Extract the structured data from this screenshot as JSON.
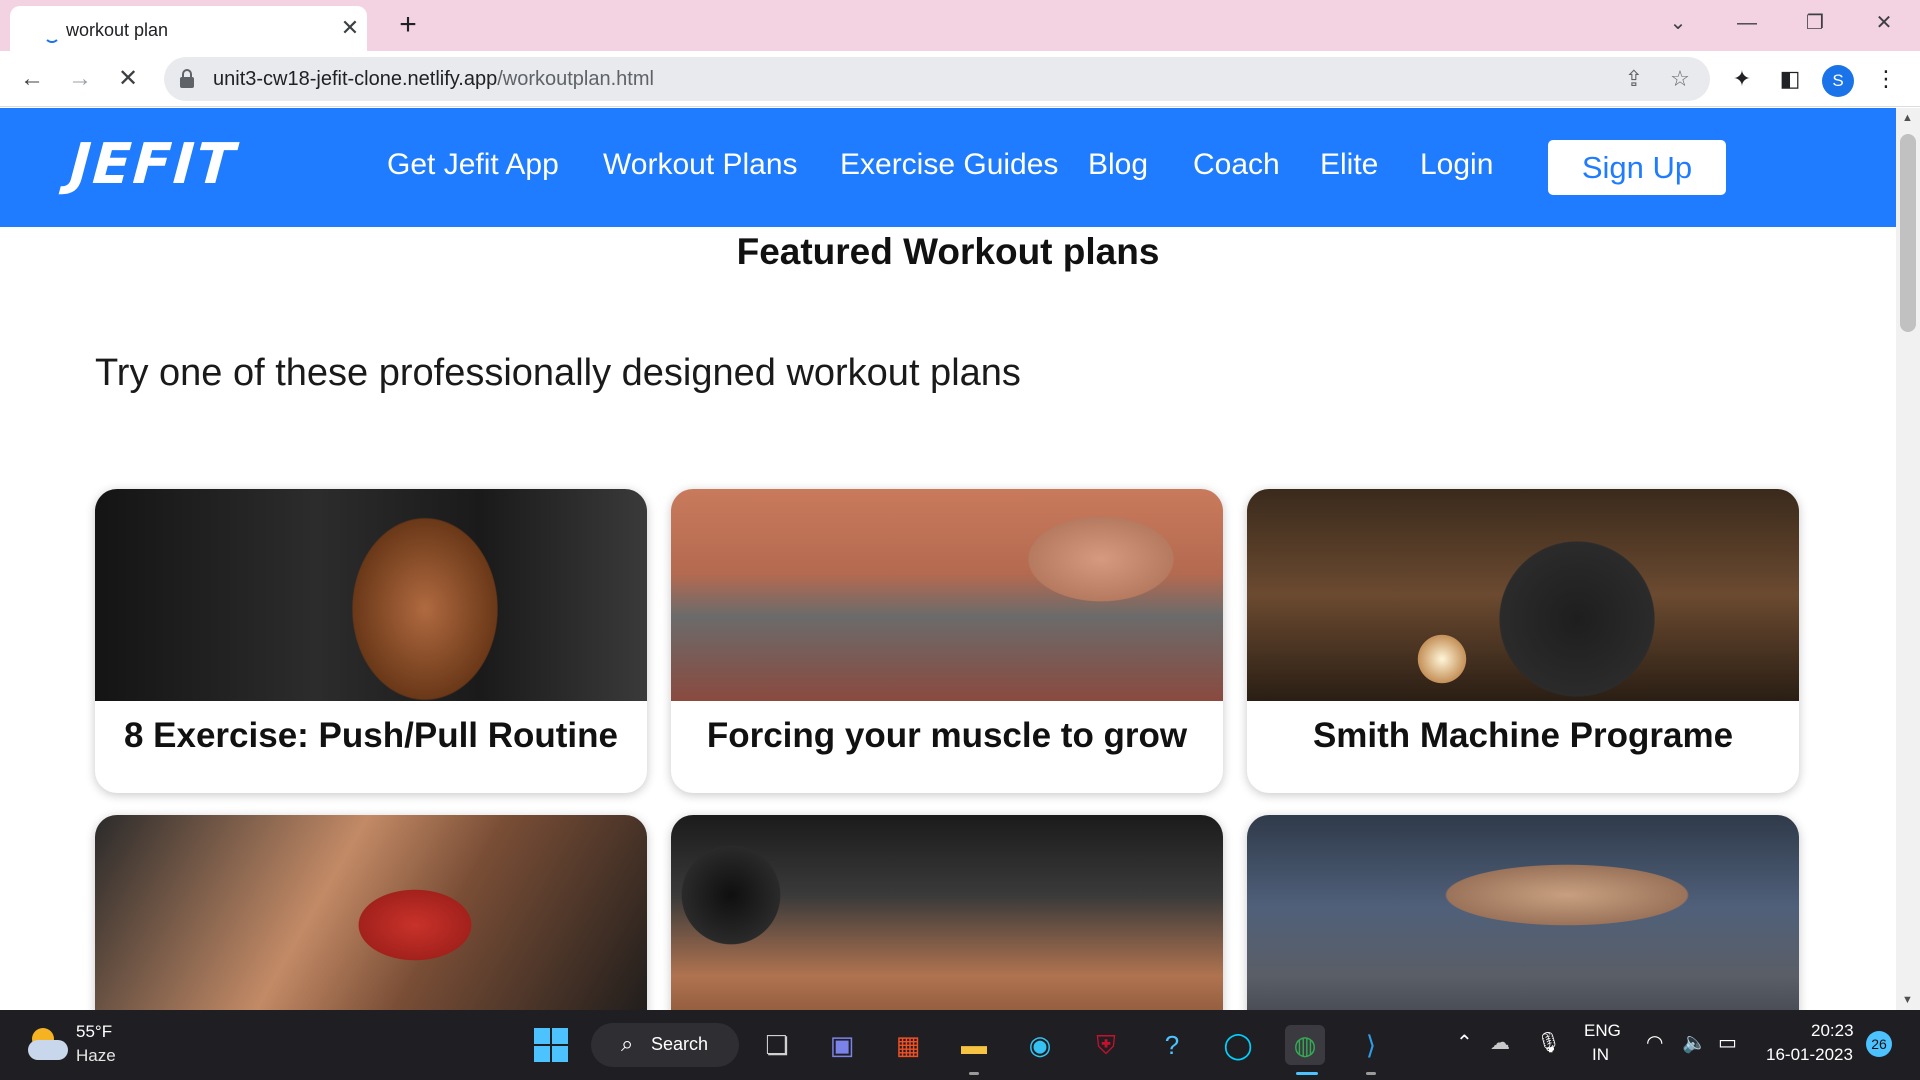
{
  "browser": {
    "tab_title": "workout plan",
    "tab_close": "✕",
    "new_tab": "+",
    "url_domain": "unit3-cw18-jefit-clone.netlify.app",
    "url_path": "/workoutplan.html",
    "profile_initial": "S"
  },
  "site": {
    "logo": "JEFIT",
    "nav": [
      "Get Jefit App",
      "Workout Plans",
      "Exercise Guides",
      "Blog",
      "Coach",
      "Elite",
      "Login"
    ],
    "signup": "Sign Up",
    "heading": "Featured Workout plans",
    "subtitle": "Try one of these professionally designed workout plans",
    "cards": [
      {
        "title": "8 Exercise: Push/Pull Routine"
      },
      {
        "title": "Forcing your muscle to grow"
      },
      {
        "title": "Smith Machine Programe"
      }
    ]
  },
  "colors": {
    "brand_blue": "#1f7cfe",
    "tab_strip": "#f3d3e2"
  },
  "taskbar": {
    "temperature": "55°F",
    "weather": "Haze",
    "search_label": "Search",
    "language": "ENG",
    "region": "IN",
    "time": "20:23",
    "date": "16-01-2023",
    "notifications": "26"
  }
}
